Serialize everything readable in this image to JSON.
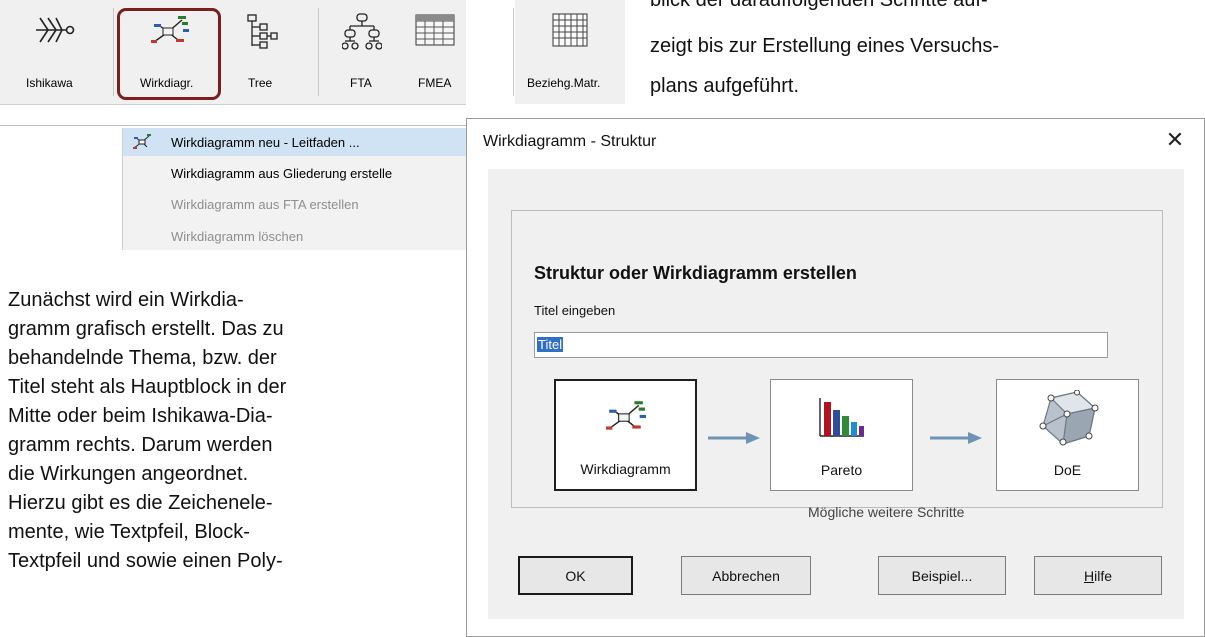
{
  "toolbar": {
    "buttons": [
      {
        "label": "Ishikawa",
        "icon": "ishikawa-icon"
      },
      {
        "label": "Wirkdiagr.",
        "icon": "wirkdiagramm-icon"
      },
      {
        "label": "Tree",
        "icon": "tree-icon"
      },
      {
        "label": "FTA",
        "icon": "fta-icon"
      },
      {
        "label": "FMEA",
        "icon": "fmea-icon"
      },
      {
        "label": "Beziehg.Matr.",
        "icon": "matrix-icon"
      }
    ],
    "highlight_color": "#7a1e1e"
  },
  "menu": {
    "items": [
      {
        "label": "Wirkdiagramm neu - Leitfaden ...",
        "state": "selected"
      },
      {
        "label": "Wirkdiagramm aus Gliederung erstelle",
        "state": "enabled"
      },
      {
        "label": "Wirkdiagramm aus FTA erstellen",
        "state": "disabled"
      },
      {
        "label": "Wirkdiagramm löschen",
        "state": "disabled"
      }
    ]
  },
  "page_text": {
    "right_lines": [
      "blick der darauffolgenden Schritte auf-",
      "zeigt bis zur Erstellung eines Versuchs-",
      "plans aufgeführt."
    ],
    "left_lines": [
      "Zunächst wird ein Wirkdia-",
      "gramm grafisch erstellt. Das zu",
      "behandelnde Thema, bzw. der",
      "Titel steht als Hauptblock in der",
      "Mitte oder beim Ishikawa-Dia-",
      "gramm rechts. Darum werden",
      "die Wirkungen angeordnet.",
      "Hierzu gibt es die Zeichenele-",
      "mente, wie Textpfeil, Block-",
      "Textpfeil und sowie einen Poly-"
    ]
  },
  "dialog": {
    "title": "Wirkdiagramm - Struktur",
    "close_symbol": "✕",
    "heading": "Struktur oder Wirkdiagramm erstellen",
    "title_label": "Titel eingeben",
    "title_value": "Titel",
    "steps": [
      {
        "label": "Wirkdiagramm",
        "icon": "wirkdiagramm-icon"
      },
      {
        "label": "Pareto",
        "icon": "pareto-chart-icon"
      },
      {
        "label": "DoE",
        "icon": "doe-cube-icon"
      }
    ],
    "steps_caption": "Mögliche weitere Schritte",
    "buttons": {
      "ok": "OK",
      "cancel": "Abbrechen",
      "example": "Beispiel...",
      "help_first": "H",
      "help_rest": "ilfe"
    }
  }
}
